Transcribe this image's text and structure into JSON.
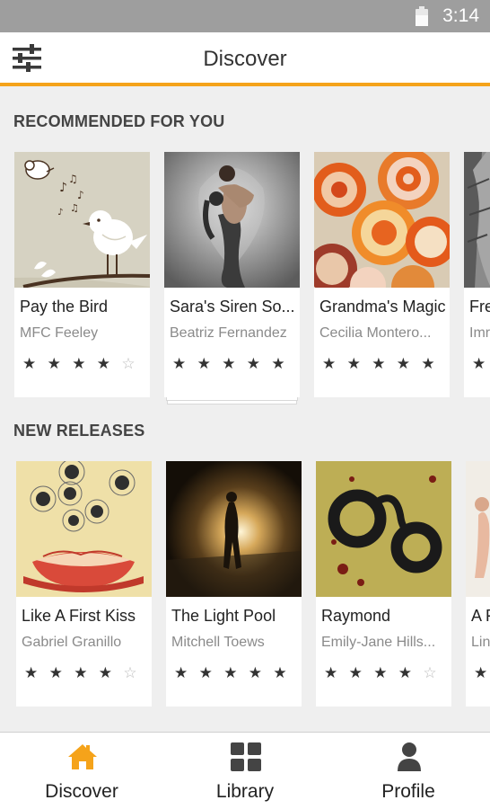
{
  "status_bar": {
    "time": "3:14"
  },
  "header": {
    "title": "Discover"
  },
  "sections": [
    {
      "title": "RECOMMENDED FOR YOU",
      "books": [
        {
          "title": "Pay the Bird",
          "author": "MFC Feeley",
          "rating": 4
        },
        {
          "title": "Sara's Siren So...",
          "author": "Beatriz Fernandez",
          "rating": 5
        },
        {
          "title": "Grandma's Magic",
          "author": "Cecilia Montero...",
          "rating": 5
        },
        {
          "title": "Fre",
          "author": "Imr",
          "rating": 1
        }
      ]
    },
    {
      "title": "NEW RELEASES",
      "books": [
        {
          "title": "Like A First Kiss",
          "author": "Gabriel Granillo",
          "rating": 4
        },
        {
          "title": "The Light Pool",
          "author": "Mitchell Toews",
          "rating": 5
        },
        {
          "title": "Raymond",
          "author": "Emily-Jane Hills...",
          "rating": 4
        },
        {
          "title": "A F",
          "author": "Lin",
          "rating": 1
        }
      ]
    }
  ],
  "nav": {
    "items": [
      {
        "label": "Discover",
        "active": true,
        "icon": "home-icon"
      },
      {
        "label": "Library",
        "active": false,
        "icon": "grid-icon"
      },
      {
        "label": "Profile",
        "active": false,
        "icon": "person-icon"
      }
    ]
  },
  "colors": {
    "accent": "#f5a31a",
    "status_bar": "#9e9e9e",
    "background": "#efefef"
  }
}
